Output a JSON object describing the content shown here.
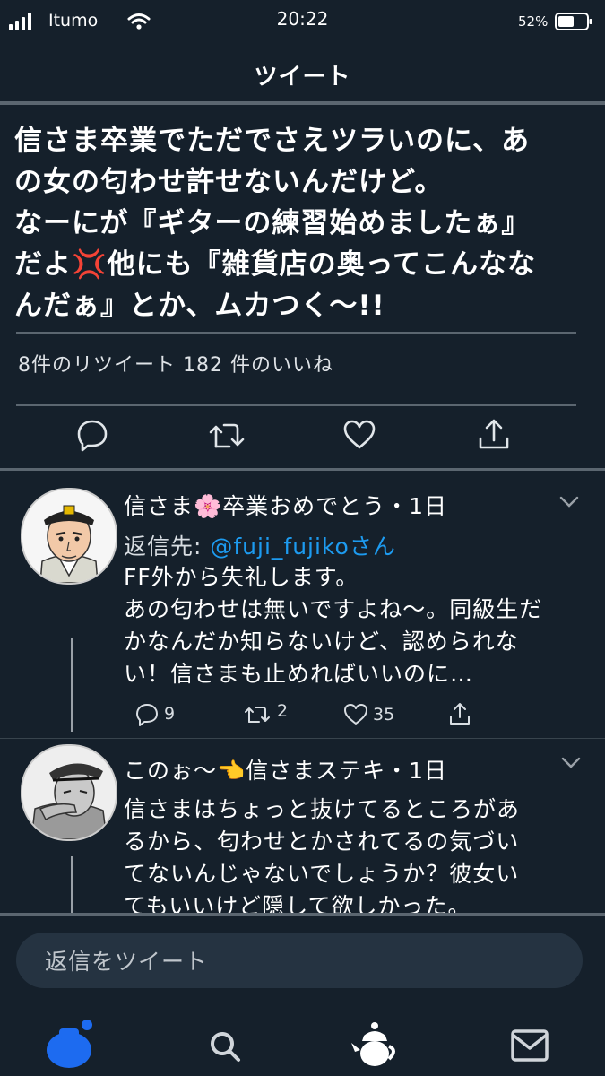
{
  "status_bar": {
    "carrier": "Itumo",
    "time": "20:22",
    "battery": "52%"
  },
  "header": {
    "title": "ツイート"
  },
  "main_tweet": {
    "text": "信さま卒業でただでさえツラいのに、あ\nの女の匂わせ許せないんだけど。\nなーにが『ギターの練習始めましたぁ』\nだよ💢他にも『雑貨店の奥ってこんなな\nんだぁ』とか、ムカつく〜!!",
    "stats": "8件のリツイート 182 件のいいね"
  },
  "replies": [
    {
      "name": "信さま🌸卒業おめでとう・1日",
      "reply_to_label": "返信先: ",
      "reply_to_handle": "@fuji_fujikoさん",
      "text": "FF外から失礼します。\nあの匂わせは無いですよね〜。同級生だ\nかなんだか知らないけど、認められな\nい！信さまも止めればいいのに…",
      "replies": "9",
      "retweets": "2",
      "likes": "35"
    },
    {
      "name": "このぉ〜👈信さまステキ・1日",
      "text": "信さまはちょっと抜けてるところがあ\nるから、匂わせとかされてるの気づい\nてないんじゃないでしょうか？彼女い\nてもいいけど隠して欲しかった。"
    }
  ],
  "composer": {
    "placeholder": "返信をツイート"
  },
  "icons": {
    "accent": "#1d9bf0",
    "background": "#15202b"
  }
}
